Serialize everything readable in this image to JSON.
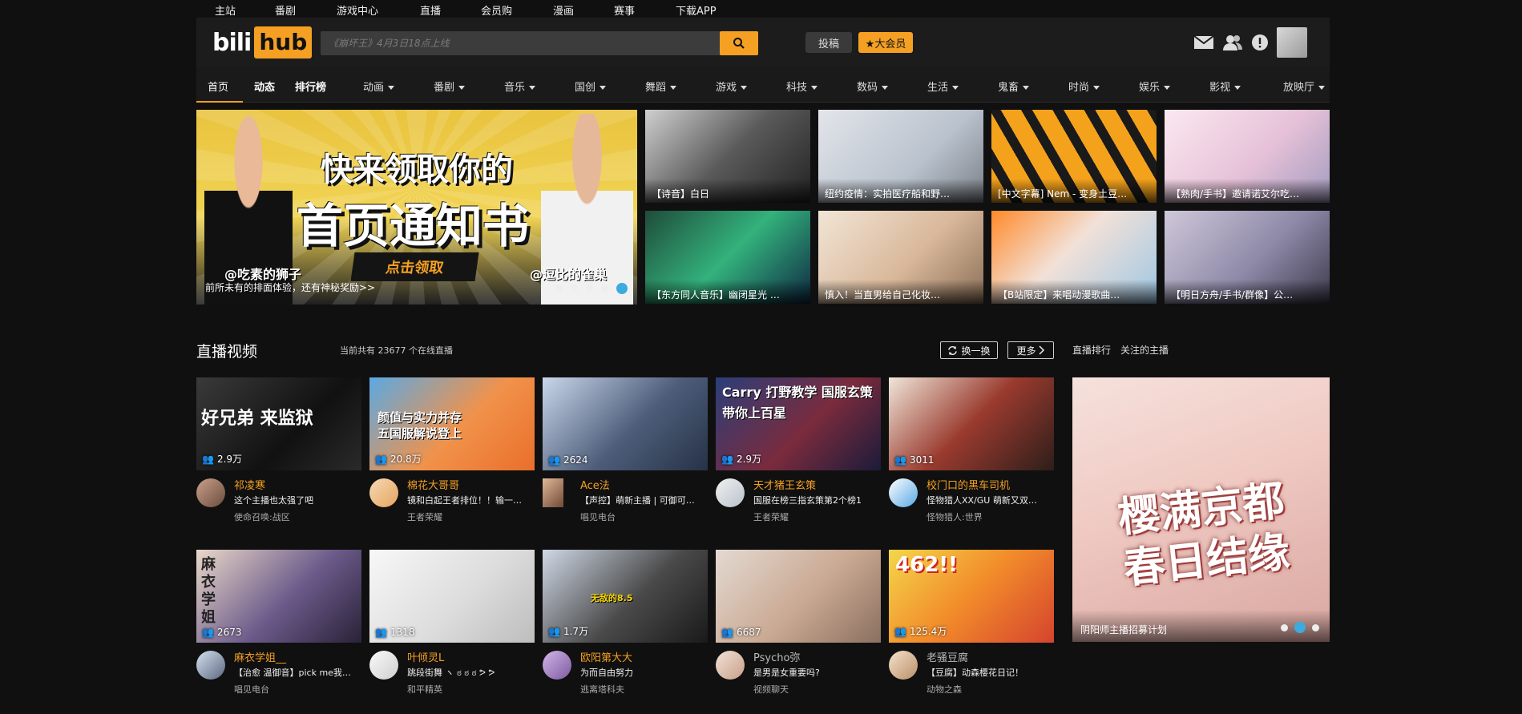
{
  "topnav": [
    "主站",
    "番剧",
    "游戏中心",
    "直播",
    "会员购",
    "漫画",
    "赛事",
    "下载APP"
  ],
  "header": {
    "logo_left": "bili",
    "logo_right": "hub",
    "search_placeholder": "《崩坏王》4月3日18点上线",
    "submit_label": "投稿",
    "vip_label": "★大会员",
    "icons": [
      "mail-icon",
      "friends-icon",
      "alert-icon"
    ]
  },
  "catnav": {
    "items": [
      "首页",
      "动态",
      "排行榜",
      "动画",
      "番剧",
      "音乐",
      "国创",
      "舞蹈",
      "游戏",
      "科技",
      "数码",
      "生活",
      "鬼畜",
      "时尚",
      "娱乐",
      "影视",
      "放映厅"
    ]
  },
  "banner": {
    "headline1": "快来领取你的",
    "headline2": "首页通知书",
    "cta": "点击领取",
    "tag1": "@吃素的狮子",
    "tag2": "@逗比的雀巢",
    "caption": "前所未有的排面体验，还有神秘奖励>>"
  },
  "thumbs": [
    {
      "caption": "【诗音】白日"
    },
    {
      "caption": "纽约疫情：实拍医疗船和野…"
    },
    {
      "caption": "[中文字幕] Nem - 变身土豆…"
    },
    {
      "caption": "【熟肉/手书】邀请诺艾尔吃…"
    },
    {
      "caption": "【东方同人音乐】幽闭星光 …"
    },
    {
      "caption": "慎入！当直男给自己化妆…"
    },
    {
      "caption": "【B站限定】来唱动漫歌曲…"
    },
    {
      "caption": "【明日方舟/手书/群像】公…"
    }
  ],
  "live": {
    "title": "直播视频",
    "subtitle": "当前共有 23677 个在线直播",
    "refresh_label": "换一换",
    "more_label": "更多",
    "rank_tabs": [
      "直播排行",
      "关注的主播"
    ],
    "cards": [
      {
        "viewers": "2.9万",
        "name": "祁凌寒",
        "desc": "这个主播也太强了吧",
        "area": "使命召唤:战区",
        "cover_text": "好兄弟 来监狱"
      },
      {
        "viewers": "20.8万",
        "name": "棉花大哥哥",
        "desc": "镜和白起王者排位！！输一…",
        "area": "王者荣耀",
        "cover_text": "颜值与实力并存 五国服解说登上"
      },
      {
        "viewers": "2624",
        "name": "Ace法",
        "desc": "【声控】萌新主播 | 可御可…",
        "area": "唱见电台",
        "cover_text": ""
      },
      {
        "viewers": "2.9万",
        "name": "天才猪王玄策",
        "desc": "国服在榜三指玄策第2个榜1",
        "area": "王者荣耀",
        "cover_text": "Carry 打野教学 国服玄策 带你上百星"
      },
      {
        "viewers": "3011",
        "name": "校门口的黑车司机",
        "desc": "怪物猎人XX/GU 萌新又双…",
        "area": "怪物猎人:世界",
        "cover_text": ""
      },
      {
        "viewers": "2673",
        "name": "麻衣学姐__",
        "desc": "【治愈 温御音】pick me我…",
        "area": "唱见电台",
        "cover_text": "麻衣学姐"
      },
      {
        "viewers": "1318",
        "name": "叶倾灵L",
        "desc": "跳段街舞 ヽ ಠ ಠ ಠ ᕗ ᕗ",
        "area": "和平精英",
        "cover_text": ""
      },
      {
        "viewers": "1.7万",
        "name": "欧阳第大大",
        "desc": "为而自由努力",
        "area": "逃离塔科夫",
        "cover_text": "无敌的8.5"
      },
      {
        "viewers": "6687",
        "name": "Psycho弥",
        "desc": "是男是女重要吗?",
        "area": "视频聊天",
        "cover_text": ""
      },
      {
        "viewers": "125.4万",
        "name": "老骚豆腐",
        "desc": "【豆腐】动森樱花日记！",
        "area": "动物之森",
        "cover_text": "462!!"
      }
    ],
    "promo": {
      "title": "樱满京都 春日结缘",
      "caption": "阴阳师主播招募计划"
    }
  },
  "colors": {
    "accent": "#f5a023",
    "bg": "#101010",
    "header": "#1c1c1c",
    "live_dot": "#3dabdd"
  }
}
